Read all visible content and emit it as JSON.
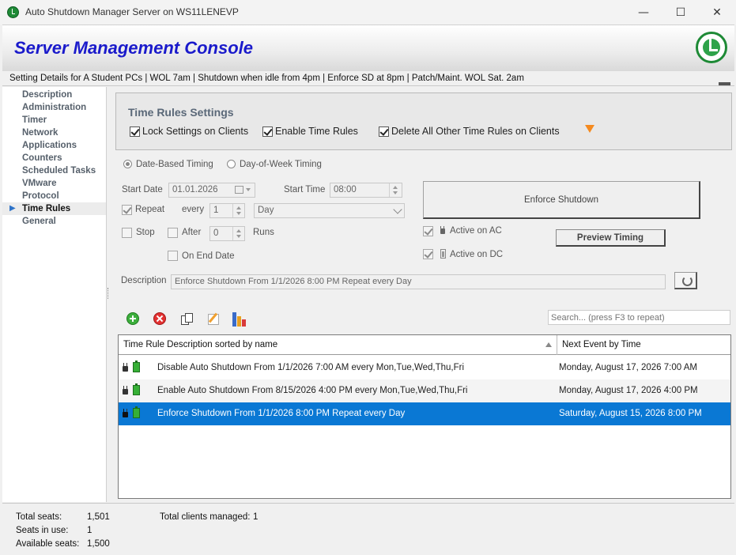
{
  "window": {
    "title": "Auto Shutdown Manager Server on WS11LENEVP",
    "minimize": "—",
    "maximize": "☐",
    "close": "✕"
  },
  "header": {
    "title": "Server Management Console"
  },
  "details": "Setting Details for A Student PCs | WOL 7am | Shutdown when idle from 4pm | Enforce SD at 8pm | Patch/Maint. WOL Sat. 2am",
  "nav": {
    "items": [
      {
        "label": "Description"
      },
      {
        "label": "Administration"
      },
      {
        "label": "Timer"
      },
      {
        "label": "Network"
      },
      {
        "label": "Applications"
      },
      {
        "label": "Counters"
      },
      {
        "label": "Scheduled Tasks"
      },
      {
        "label": "VMware"
      },
      {
        "label": "Protocol"
      },
      {
        "label": "Time Rules",
        "active": true
      },
      {
        "label": "General"
      }
    ]
  },
  "settings": {
    "title": "Time Rules Settings",
    "lock_label": "Lock Settings on Clients",
    "enable_label": "Enable Time Rules",
    "delete_label": "Delete All Other Time Rules on Clients"
  },
  "timing": {
    "date_based_label": "Date-Based Timing",
    "dow_label": "Day-of-Week Timing",
    "start_date_label": "Start Date",
    "start_date_value": "01.01.2026",
    "start_time_label": "Start Time",
    "start_time_value": "08:00",
    "repeat_label": "Repeat",
    "every_label": "every",
    "every_value": "1",
    "period_value": "Day",
    "stop_label": "Stop",
    "after_label": "After",
    "after_value": "0",
    "runs_label": "Runs",
    "on_end_date_label": "On End Date",
    "active_ac_label": "Active on AC",
    "active_dc_label": "Active on DC",
    "enforce_button": "Enforce Shutdown",
    "preview_button": "Preview Timing",
    "description_label": "Description",
    "description_value": "Enforce Shutdown From 1/1/2026 8:00 PM Repeat every Day"
  },
  "search": {
    "placeholder": "Search... (press F3 to repeat)"
  },
  "table": {
    "col1": "Time Rule Description sorted by name",
    "col2": "Next Event by Time",
    "rows": [
      {
        "desc": "Disable Auto Shutdown From 1/1/2026 7:00 AM every Mon,Tue,Wed,Thu,Fri",
        "next": "Monday, August 17, 2026 7:00 AM"
      },
      {
        "desc": "Enable Auto Shutdown From 8/15/2026 4:00 PM every Mon,Tue,Wed,Thu,Fri",
        "next": "Monday, August 17, 2026 4:00 PM"
      },
      {
        "desc": "Enforce Shutdown From 1/1/2026 8:00 PM Repeat every Day",
        "next": "Saturday, August 15, 2026 8:00 PM"
      }
    ]
  },
  "status": {
    "total_seats_label": "Total seats:",
    "total_seats_value": "1,501",
    "seats_in_use_label": "Seats in use:",
    "seats_in_use_value": "1",
    "available_label": "Available seats:",
    "available_value": "1,500",
    "clients_label": "Total clients managed:",
    "clients_value": "1"
  },
  "colors": {
    "title_blue": "#1a1acb",
    "selection": "#0a78d4",
    "orange": "#f58a1f",
    "brand_green": "#1e8a36"
  }
}
